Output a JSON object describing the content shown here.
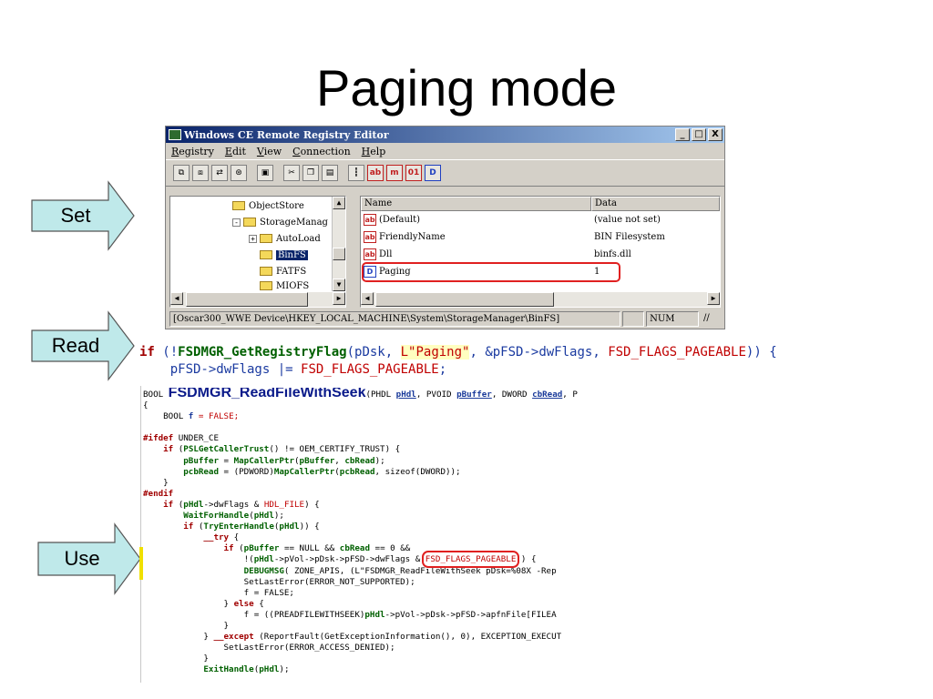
{
  "slide": {
    "title": "Paging mode"
  },
  "callouts": {
    "set": "Set",
    "read": "Read",
    "use": "Use"
  },
  "registry_editor": {
    "title": "Windows CE Remote Registry Editor",
    "window_buttons": {
      "minimize": "_",
      "maximize": "□",
      "close": "X"
    },
    "menu": [
      "Registry",
      "Edit",
      "View",
      "Connection",
      "Help"
    ],
    "tree": {
      "items": [
        {
          "label": "ObjectStore",
          "expander": ""
        },
        {
          "label": "StorageManag",
          "expander": "-"
        },
        {
          "label": "AutoLoad",
          "expander": "+"
        },
        {
          "label": "BinFS",
          "expander": "",
          "selected": true
        },
        {
          "label": "FATFS",
          "expander": ""
        },
        {
          "label": "MIOFS",
          "expander": ""
        }
      ]
    },
    "list": {
      "columns": [
        "Name",
        "Data"
      ],
      "rows": [
        {
          "icon": "ab",
          "name": "(Default)",
          "data": "(value not set)"
        },
        {
          "icon": "ab",
          "name": "FriendlyName",
          "data": "BIN Filesystem"
        },
        {
          "icon": "ab",
          "name": "Dll",
          "data": "binfs.dll"
        },
        {
          "icon": "D",
          "name": "Paging",
          "data": "1",
          "highlighted": true
        }
      ]
    },
    "status": {
      "path": "[Oscar300_WWE Device\\HKEY_LOCAL_MACHINE\\System\\StorageManager\\BinFS]",
      "num": "NUM"
    },
    "colors": {
      "titlebar": "#0a246a",
      "highlight_border": "#e02020"
    }
  },
  "read_code": {
    "line1": {
      "kw_if": "if",
      "open": " (!",
      "fn": "FSDMGR_GetRegistryFlag",
      "args1": "(pDsk, ",
      "str": "L\"Paging\"",
      "args2": ", &pFSD->dwFlags, ",
      "mac": "FSD_FLAGS_PAGEABLE",
      "close": ")) {"
    },
    "line2": {
      "indent_expr": "    pFSD->dwFlags |= ",
      "mac": "FSD_FLAGS_PAGEABLE",
      "end": ";"
    }
  },
  "use_code": {
    "sig": {
      "ret": "BOOL ",
      "fn": "FSDMGR_ReadFileWithSeek",
      "p1": "(PHDL ",
      "a1": "pHdl",
      "p2": ", PVOID ",
      "a2": "pBuffer",
      "p3": ", DWORD ",
      "a3": "cbRead",
      "p4": ", P"
    },
    "lines": {
      "l2": "{",
      "l3a": "    BOOL ",
      "l3b": "f",
      "l3c": " = FALSE;",
      "l5a": "#ifdef",
      "l5b": " UNDER_CE",
      "l6a": "    ",
      "l6b": "if",
      "l6c": " (",
      "l6d": "PSLGetCallerTrust",
      "l6e": "() != OEM_CERTIFY_TRUST) {",
      "l7a": "        ",
      "l7b": "pBuffer",
      "l7c": " = ",
      "l7d": "MapCallerPtr",
      "l7e": "(",
      "l7f": "pBuffer",
      "l7g": ", ",
      "l7h": "cbRead",
      "l7i": ");",
      "l8a": "        ",
      "l8b": "pcbRead",
      "l8c": " = (PDWORD)",
      "l8d": "MapCallerPtr",
      "l8e": "(",
      "l8f": "pcbRead",
      "l8g": ", sizeof(DWORD));",
      "l9": "    }",
      "l10": "#endif",
      "l11a": "    ",
      "l11b": "if",
      "l11c": " (",
      "l11d": "pHdl",
      "l11e": "->dwFlags & ",
      "l11f": "HDL_FILE",
      "l11g": ") {",
      "l12a": "        ",
      "l12b": "WaitForHandle",
      "l12c": "(",
      "l12d": "pHdl",
      "l12e": ");",
      "l13a": "        ",
      "l13b": "if",
      "l13c": " (",
      "l13d": "TryEnterHandle",
      "l13e": "(",
      "l13f": "pHdl",
      "l13g": ")) {",
      "l14a": "            ",
      "l14b": "__try",
      "l14c": " {",
      "l15a": "                ",
      "l15b": "if",
      "l15c": " (",
      "l15d": "pBuffer",
      "l15e": " == NULL && ",
      "l15f": "cbRead",
      "l15g": " == 0 &&",
      "l16a": "                    !(",
      "l16b": "pHdl",
      "l16c": "->pVol->pDsk->pFSD->dwFlags & ",
      "l16d": "FSD_FLAGS_PAGEABLE",
      "l16e": ")) {",
      "l17a": "                    ",
      "l17b": "DEBUGMSG",
      "l17c": "( ZONE_APIS, (L\"FSDMGR_ReadFileWithSeek pDsk=%08X -Rep",
      "l18": "                    SetLastError(ERROR_NOT_SUPPORTED);",
      "l19": "                    f = FALSE;",
      "l20a": "                } ",
      "l20b": "else",
      "l20c": " {",
      "l21a": "                    f = ((PREADFILEWITHSEEK)",
      "l21b": "pHdl",
      "l21c": "->pVol->pDsk->pFSD->apfnFile[FILEA",
      "l22": "                }",
      "l23a": "            } ",
      "l23b": "__except",
      "l23c": " (ReportFault(GetExceptionInformation(), 0), EXCEPTION_EXECUT",
      "l24": "                SetLastError(ERROR_ACCESS_DENIED);",
      "l25": "            }",
      "l26a": "            ",
      "l26b": "ExitHandle",
      "l26c": "(",
      "l26d": "pHdl",
      "l26e": ");"
    }
  }
}
